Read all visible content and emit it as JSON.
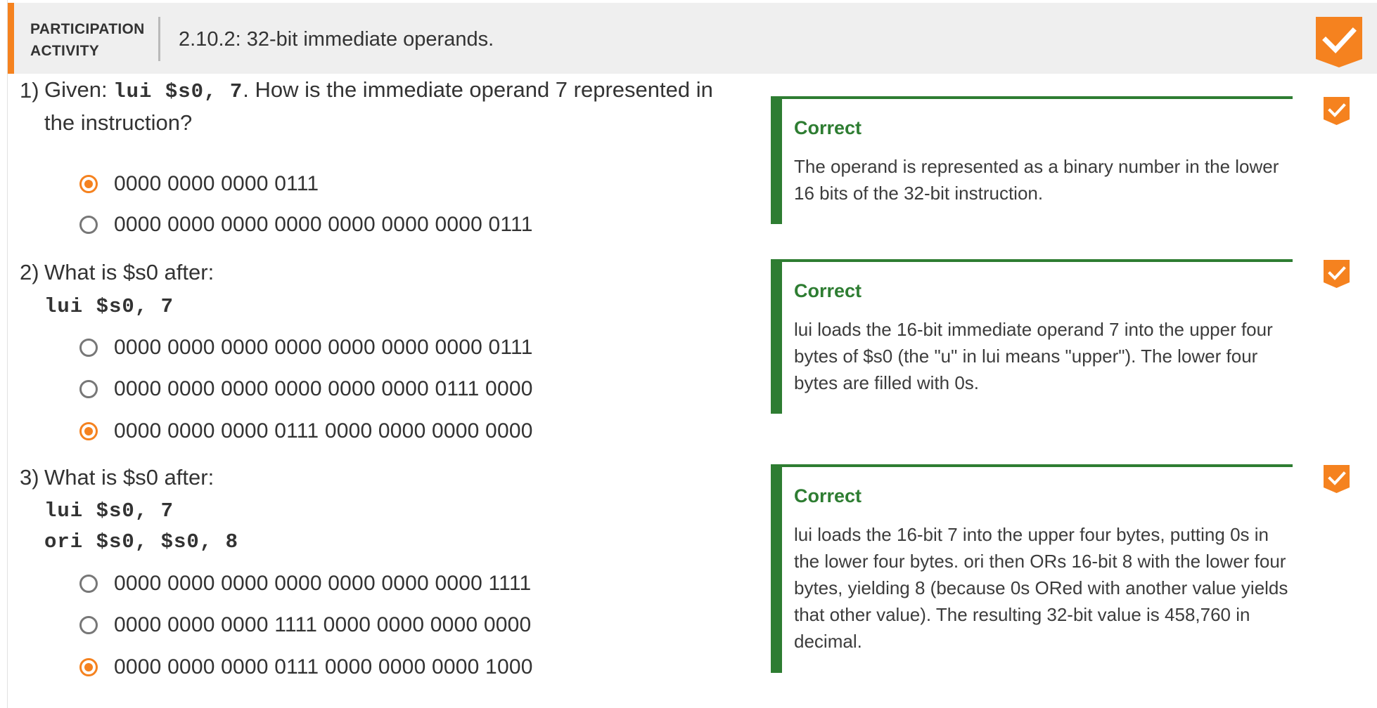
{
  "header": {
    "activity_label_line1": "PARTICIPATION",
    "activity_label_line2": "ACTIVITY",
    "title": "2.10.2: 32-bit immediate operands.",
    "completion_icon": "checkmark-icon"
  },
  "colors": {
    "accent": "#f5821f",
    "correct": "#2e7d32",
    "header_bg": "#efefef"
  },
  "questions": [
    {
      "number": "1)",
      "prompt_prefix": "Given: ",
      "prompt_code": "lui $s0, 7",
      "prompt_line1_suffix": ". How is the immediate operand 7 represented in",
      "prompt_line2": "the instruction?",
      "options": [
        {
          "label": "0000 0000 0000 0111",
          "selected": true
        },
        {
          "label": "0000 0000 0000 0000 0000 0000 0000 0111",
          "selected": false
        }
      ],
      "feedback": {
        "title": "Correct",
        "text": "The operand is represented as a binary number in the lower 16 bits of the 32-bit instruction."
      }
    },
    {
      "number": "2)",
      "prompt": "What is $s0 after:",
      "code_lines": [
        "lui $s0, 7"
      ],
      "options": [
        {
          "label": "0000 0000 0000 0000 0000 0000 0000 0111",
          "selected": false
        },
        {
          "label": "0000 0000 0000 0000 0000 0000 0111 0000",
          "selected": false
        },
        {
          "label": "0000 0000 0000 0111 0000 0000 0000 0000",
          "selected": true
        }
      ],
      "feedback": {
        "title": "Correct",
        "text": "lui loads the 16-bit immediate operand 7 into the upper four bytes of $s0 (the \"u\" in lui means \"upper\"). The lower four bytes are filled with 0s."
      }
    },
    {
      "number": "3)",
      "prompt": "What is $s0 after:",
      "code_lines": [
        "lui $s0, 7",
        "ori $s0, $s0, 8"
      ],
      "options": [
        {
          "label": "0000 0000 0000 0000 0000 0000 0000 1111",
          "selected": false
        },
        {
          "label": "0000 0000 0000 1111 0000 0000 0000 0000",
          "selected": false
        },
        {
          "label": "0000 0000 0000 0111 0000 0000 0000 1000",
          "selected": true
        }
      ],
      "feedback": {
        "title": "Correct",
        "text": "lui loads the 16-bit 7 into the upper four bytes, putting 0s in the lower four bytes. ori then ORs 16-bit 8 with the lower four bytes, yielding 8 (because 0s ORed with another value yields that other value). The resulting 32-bit value is 458,760 in decimal."
      }
    }
  ]
}
